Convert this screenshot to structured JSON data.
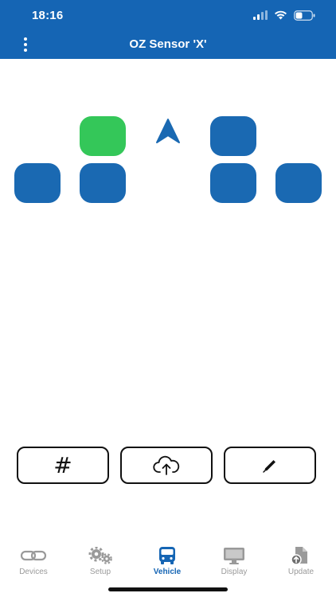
{
  "status_bar": {
    "time": "18:16"
  },
  "header": {
    "title": "OZ Sensor 'X'"
  },
  "vehicle": {
    "tiles": [
      {
        "id": "tile-front-left",
        "state": "active",
        "color": "#34c759"
      },
      {
        "id": "tile-front-right",
        "state": "inactive",
        "color": "#1a69b2"
      },
      {
        "id": "tile-rear-left-outer",
        "state": "inactive",
        "color": "#1a69b2"
      },
      {
        "id": "tile-rear-left-inner",
        "state": "inactive",
        "color": "#1a69b2"
      },
      {
        "id": "tile-rear-right-inner",
        "state": "inactive",
        "color": "#1a69b2"
      },
      {
        "id": "tile-rear-right-outer",
        "state": "inactive",
        "color": "#1a69b2"
      }
    ],
    "direction_icon": "arrow-up-icon"
  },
  "actions": {
    "hash_label": "#",
    "upload_icon": "cloud-upload-icon",
    "edit_icon": "pencil-icon"
  },
  "tabs": [
    {
      "label": "Devices",
      "icon": "link-icon",
      "active": false
    },
    {
      "label": "Setup",
      "icon": "gears-icon",
      "active": false
    },
    {
      "label": "Vehicle",
      "icon": "bus-icon",
      "active": true
    },
    {
      "label": "Display",
      "icon": "monitor-icon",
      "active": false
    },
    {
      "label": "Update",
      "icon": "file-upload-icon",
      "active": false
    }
  ],
  "colors": {
    "accent": "#1565b4",
    "tile_blue": "#1a69b2",
    "tile_green": "#34c759",
    "tab_inactive": "#9a9a9a"
  }
}
